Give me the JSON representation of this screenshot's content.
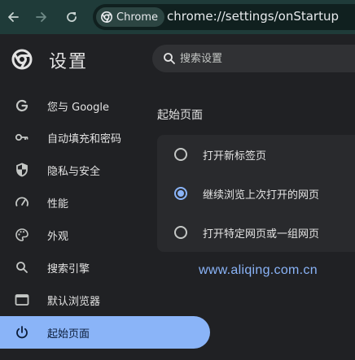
{
  "browser": {
    "back_label": "Back",
    "forward_label": "Forward",
    "reload_label": "Reload",
    "chip_label": "Chrome",
    "url": "chrome://settings/onStartup"
  },
  "header": {
    "title": "设置",
    "search_placeholder": "搜索设置"
  },
  "sidebar": {
    "items": [
      {
        "label": "您与 Google",
        "icon": "google-icon",
        "active": false
      },
      {
        "label": "自动填充和密码",
        "icon": "key-icon",
        "active": false
      },
      {
        "label": "隐私与安全",
        "icon": "shield-icon",
        "active": false
      },
      {
        "label": "性能",
        "icon": "speedometer-icon",
        "active": false
      },
      {
        "label": "外观",
        "icon": "palette-icon",
        "active": false
      },
      {
        "label": "搜索引擎",
        "icon": "search-icon",
        "active": false
      },
      {
        "label": "默认浏览器",
        "icon": "browser-window-icon",
        "active": false
      },
      {
        "label": "起始页面",
        "icon": "power-icon",
        "active": true
      }
    ]
  },
  "main": {
    "section_title": "起始页面",
    "options": [
      {
        "label": "打开新标签页",
        "checked": false
      },
      {
        "label": "继续浏览上次打开的网页",
        "checked": true
      },
      {
        "label": "打开特定网页或一组网页",
        "checked": false
      }
    ]
  },
  "watermark": "www.aliqing.com.cn",
  "colors": {
    "toolbar_bg": "#1f3b39",
    "page_bg": "#202124",
    "accent": "#8ab4f8",
    "card_bg": "#292a2d"
  }
}
